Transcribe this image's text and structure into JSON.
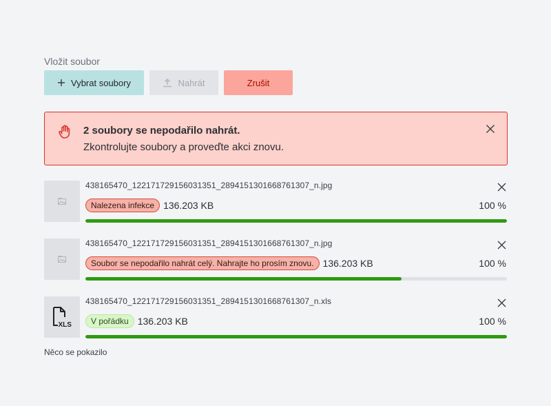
{
  "field_label": "Vložit soubor",
  "toolbar": {
    "select_label": "Vybrat soubory",
    "upload_label": "Nahrát",
    "cancel_label": "Zrušit"
  },
  "alert": {
    "title": "2 soubory se nepodařilo nahrát.",
    "text": "Zkontrolujte soubory a proveďte akci znovu."
  },
  "files": [
    {
      "name": "438165470_1221717291560313​51_2894151301668761307_n.jpg",
      "badge": "Nalezena infekce",
      "badge_status": "error",
      "size": "136.203 KB",
      "percent_label": "100 %",
      "progress": 1.0,
      "icon": "image-icon"
    },
    {
      "name": "438165470_1221717291560313​51_2894151301668761307_n.jpg",
      "badge": "Soubor se nepodařilo nahrát celý. Nahrajte ho prosím znovu.",
      "badge_status": "error",
      "size": "136.203 KB",
      "percent_label": "100 %",
      "progress": 0.75,
      "icon": "image-icon"
    },
    {
      "name": "438165470_1221717291560313​51_2894151301668761307_n.xls",
      "badge": "V pořádku",
      "badge_status": "ok",
      "size": "136.203 KB",
      "percent_label": "100 %",
      "progress": 1.0,
      "icon": "xls-file-icon"
    }
  ],
  "error_message": "Něco se pokazilo",
  "colors": {
    "select_bg": "#b9e1e2",
    "cancel_bg": "#fba59c",
    "alert_bg": "#fdd1cc",
    "alert_border": "#d8342a",
    "progress": "#2f9a10"
  }
}
